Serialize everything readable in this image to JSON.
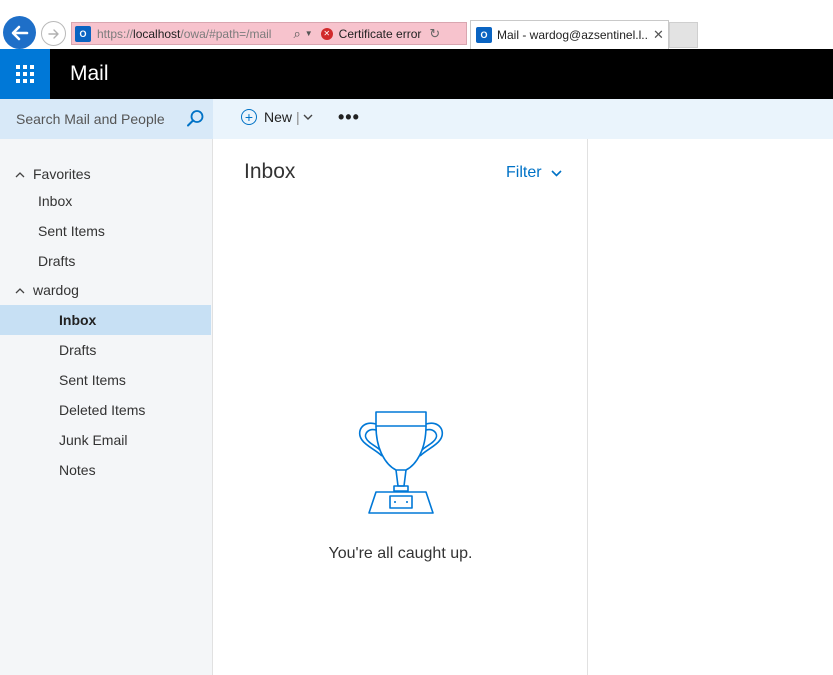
{
  "browser": {
    "url_prefix": "https://",
    "url_host": "localhost",
    "url_path": "/owa/#path=/mail",
    "cert_error": "Certificate error",
    "tab_title": "Mail - wardog@azsentinel.l...",
    "favicon_letter": "O"
  },
  "app": {
    "title": "Mail"
  },
  "command_bar": {
    "search_placeholder": "Search Mail and People",
    "new_label": "New",
    "new_sep": "|",
    "more_label": "•••"
  },
  "nav": {
    "favorites": {
      "label": "Favorites",
      "items": [
        "Inbox",
        "Sent Items",
        "Drafts"
      ]
    },
    "account": {
      "label": "wardog",
      "items": [
        "Inbox",
        "Drafts",
        "Sent Items",
        "Deleted Items",
        "Junk Email",
        "Notes"
      ],
      "selected": "Inbox"
    }
  },
  "message_list": {
    "title": "Inbox",
    "filter_label": "Filter",
    "empty_message": "You're all caught up."
  },
  "colors": {
    "accent": "#0078d7",
    "link": "#0072c6",
    "selected_bg": "#c7e0f4",
    "cert_bar": "#f7c3cd"
  }
}
